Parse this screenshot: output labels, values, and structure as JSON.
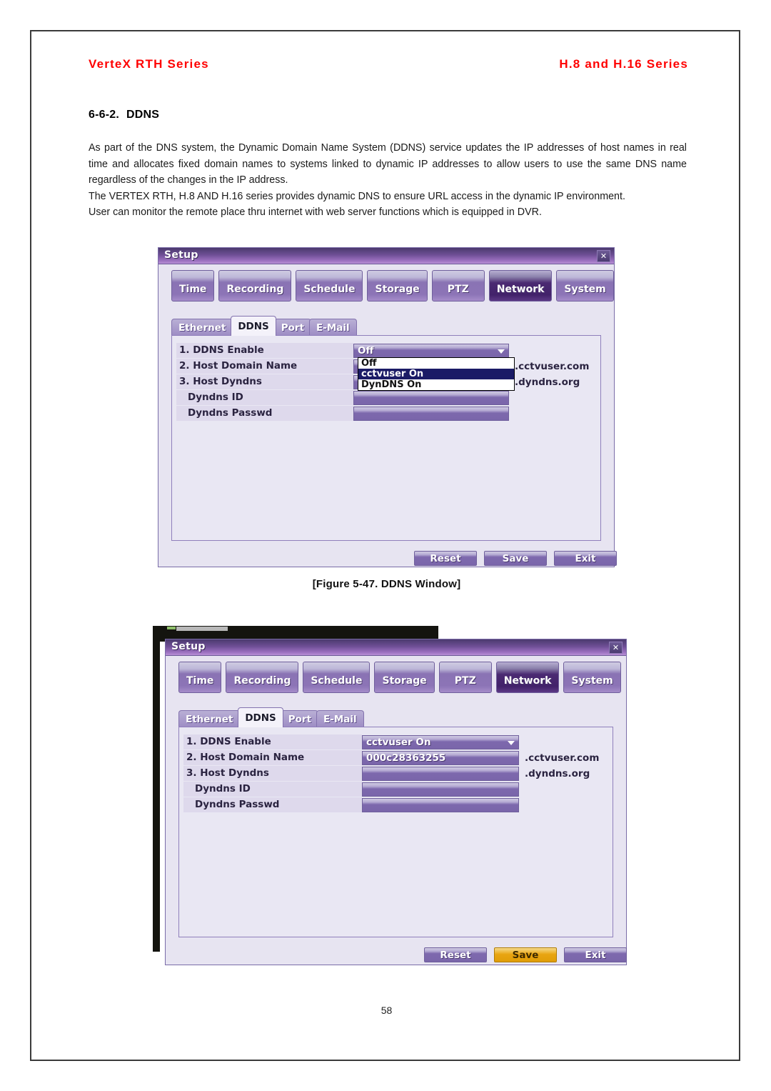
{
  "header": {
    "left": "VerteX RTH Series",
    "right": "H.8 and H.16 Series",
    "accent_color": "#ff0000"
  },
  "section": {
    "number": "6-6-2.",
    "title": "DDNS"
  },
  "body": {
    "p1": "As part of the DNS system, the Dynamic Domain Name System (DDNS) service updates the IP addresses of host names in real time and allocates fixed domain names to systems linked to dynamic IP addresses to allow users to use the same DNS name regardless of the changes in the IP address.",
    "p2": "The VERTEX RTH, H.8 AND H.16 series provides dynamic DNS to ensure URL access in the dynamic IP environment.",
    "p3": "User can monitor the remote place thru internet with web server functions which is equipped in DVR."
  },
  "figure_caption": "[Figure 5-47. DDNS Window]",
  "page_number": "58",
  "window1": {
    "title": "Setup",
    "close_icon": "close-icon",
    "main_tabs": [
      {
        "label": "Time",
        "selected": false
      },
      {
        "label": "Recording",
        "selected": false
      },
      {
        "label": "Schedule",
        "selected": false
      },
      {
        "label": "Storage",
        "selected": false
      },
      {
        "label": "PTZ",
        "selected": false
      },
      {
        "label": "Network",
        "selected": true
      },
      {
        "label": "System",
        "selected": false
      }
    ],
    "sub_tabs": [
      {
        "label": "Ethernet",
        "active": false
      },
      {
        "label": "DDNS",
        "active": true
      },
      {
        "label": "Port",
        "active": false
      },
      {
        "label": "E-Mail",
        "active": false
      }
    ],
    "rows": [
      {
        "label": "1. DDNS Enable",
        "value": "Off",
        "suffix": ""
      },
      {
        "label": "2. Host Domain Name",
        "value": "",
        "suffix": ".cctvuser.com"
      },
      {
        "label": "3. Host Dyndns",
        "value": "",
        "suffix": ".dyndns.org"
      },
      {
        "label": "Dyndns ID",
        "value": "",
        "suffix": ""
      },
      {
        "label": "Dyndns Passwd",
        "value": "",
        "suffix": ""
      }
    ],
    "dropdown": {
      "open": true,
      "options": [
        {
          "label": "Off",
          "highlighted": false
        },
        {
          "label": "cctvuser On",
          "highlighted": true
        },
        {
          "label": "DynDNS On",
          "highlighted": false
        }
      ],
      "highlight_color": "#1b1b66"
    },
    "buttons": [
      {
        "label": "Reset",
        "highlighted": false
      },
      {
        "label": "Save",
        "highlighted": false
      },
      {
        "label": "Exit",
        "highlighted": false
      }
    ]
  },
  "window2": {
    "title": "Setup",
    "close_icon": "close-icon",
    "main_tabs": [
      {
        "label": "Time",
        "selected": false
      },
      {
        "label": "Recording",
        "selected": false
      },
      {
        "label": "Schedule",
        "selected": false
      },
      {
        "label": "Storage",
        "selected": false
      },
      {
        "label": "PTZ",
        "selected": false
      },
      {
        "label": "Network",
        "selected": true
      },
      {
        "label": "System",
        "selected": false
      }
    ],
    "sub_tabs": [
      {
        "label": "Ethernet",
        "active": false
      },
      {
        "label": "DDNS",
        "active": true
      },
      {
        "label": "Port",
        "active": false
      },
      {
        "label": "E-Mail",
        "active": false
      }
    ],
    "rows": [
      {
        "label": "1. DDNS Enable",
        "value": "cctvuser On",
        "suffix": ""
      },
      {
        "label": "2. Host Domain Name",
        "value": "000c28363255",
        "suffix": ".cctvuser.com"
      },
      {
        "label": "3. Host Dyndns",
        "value": "",
        "suffix": ".dyndns.org"
      },
      {
        "label": "Dyndns ID",
        "value": "",
        "suffix": ""
      },
      {
        "label": "Dyndns Passwd",
        "value": "",
        "suffix": ""
      }
    ],
    "buttons": [
      {
        "label": "Reset",
        "highlighted": false
      },
      {
        "label": "Save",
        "highlighted": true
      },
      {
        "label": "Exit",
        "highlighted": false
      }
    ],
    "save_highlight_color": "#e9a512"
  }
}
